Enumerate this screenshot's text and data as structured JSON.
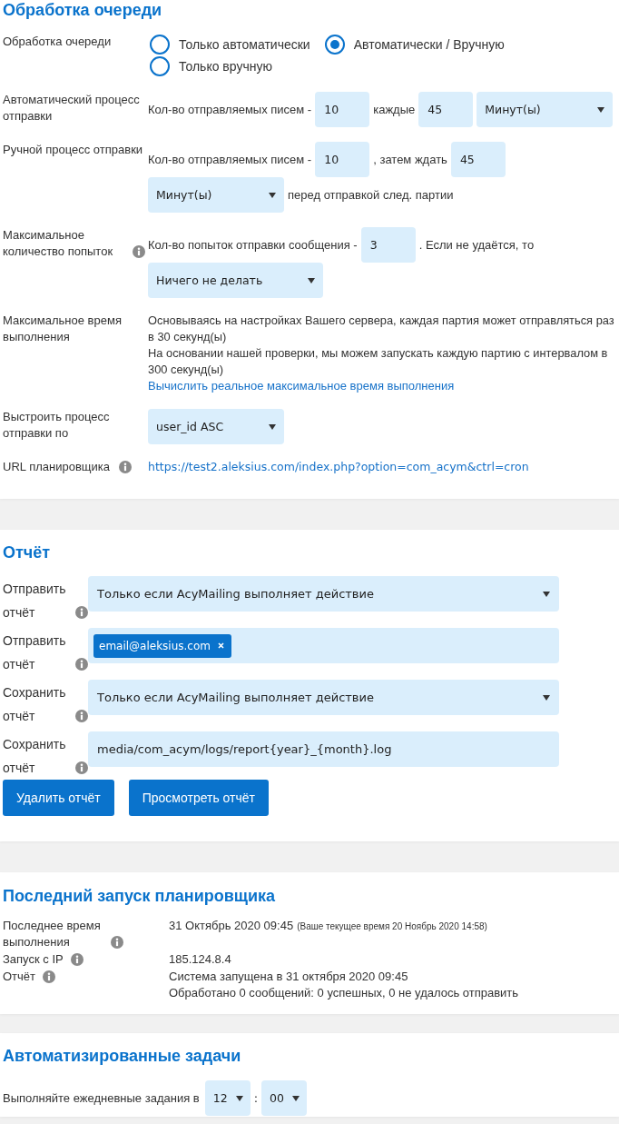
{
  "queue": {
    "title": "Обработка очереди",
    "rows": [
      {
        "label": "Обработка очереди",
        "info": false,
        "parts": [
          {
            "kind": "radio",
            "label": "Только автоматически",
            "selected": false
          },
          {
            "kind": "radio",
            "label": "Автоматически / Вручную",
            "selected": true
          },
          {
            "kind": "radio",
            "label": "Только вручную",
            "selected": false
          }
        ]
      },
      {
        "label": "Автоматический процесс отправки",
        "info": false,
        "parts": [
          {
            "kind": "text",
            "text": "Кол-во отправляемых писем -"
          },
          {
            "kind": "input",
            "value": "10"
          },
          {
            "kind": "text",
            "text": "каждые"
          },
          {
            "kind": "input",
            "value": "45"
          },
          {
            "kind": "select",
            "value": "Минут(ы)"
          }
        ]
      },
      {
        "label": "Ручной процесс отправки",
        "info": false,
        "parts": [
          {
            "kind": "text",
            "text": "Кол-во отправляемых писем -"
          },
          {
            "kind": "input",
            "value": "10"
          },
          {
            "kind": "text",
            "text": ", затем ждать"
          },
          {
            "kind": "input",
            "value": "45"
          },
          {
            "kind": "select",
            "value": "Минут(ы)"
          },
          {
            "kind": "text",
            "text": "перед отправкой след. партии"
          }
        ]
      },
      {
        "label": "Максимальное количество попыток",
        "info": true,
        "parts": [
          {
            "kind": "text",
            "text": "Кол-во попыток отправки сообщения -"
          },
          {
            "kind": "input",
            "value": "3"
          },
          {
            "kind": "text",
            "text": ". Если не удаётся, то"
          },
          {
            "kind": "select",
            "value": "Ничего не делать"
          }
        ]
      },
      {
        "label": "Максимальное время выполнения",
        "info": false,
        "parts": [
          {
            "kind": "paragraph",
            "text": "Основываясь на настройках Вашего сервера, каждая партия может отправляться раз в 30 секунд(ы)"
          },
          {
            "kind": "paragraph",
            "text": "На основании нашей проверки, мы можем запускать каждую партию с интервалом в 300 секунд(ы)"
          },
          {
            "kind": "link",
            "text": "Вычислить реальное максимальное время выполнения"
          }
        ]
      },
      {
        "label": "Выстроить процесс отправки по",
        "info": false,
        "parts": [
          {
            "kind": "select",
            "value": "user_id ASC"
          }
        ]
      },
      {
        "label": "URL планировщика",
        "info": true,
        "parts": [
          {
            "kind": "url",
            "text": "https://test2.aleksius.com/index.php?option=com_acym&ctrl=cron"
          }
        ]
      }
    ]
  },
  "report": {
    "title": "Отчёт",
    "rows": [
      {
        "label": "Отправить отчёт",
        "info": true,
        "field": {
          "kind": "select",
          "value": "Только если AcyMailing выполняет действие"
        }
      },
      {
        "label": "Отправить отчёт",
        "info": true,
        "field": {
          "kind": "tags",
          "tags": [
            "email@aleksius.com"
          ]
        }
      },
      {
        "label": "Сохранить отчёт",
        "info": true,
        "field": {
          "kind": "select",
          "value": "Только если AcyMailing выполняет действие"
        }
      },
      {
        "label": "Сохранить отчёт",
        "info": true,
        "field": {
          "kind": "input",
          "value": "media/com_acym/logs/report{year}_{month}.log"
        }
      }
    ],
    "buttons": [
      "Удалить отчёт",
      "Просмотреть отчёт"
    ]
  },
  "last_run": {
    "title": "Последний запуск планировщика",
    "rows": [
      {
        "label": "Последнее время выполнения",
        "info": true,
        "values": [
          {
            "text": "31 Октябрь 2020 09:45",
            "note": "(Ваше текущее время 20 Ноябрь 2020 14:58)"
          }
        ]
      },
      {
        "label": "Запуск с IP",
        "info": true,
        "values": [
          {
            "text": "185.124.8.4"
          }
        ]
      },
      {
        "label": "Отчёт",
        "info": true,
        "values": [
          {
            "text": "Система запущена в 31 октября 2020 09:45"
          },
          {
            "text": "Обработано 0 сообщений: 0 успешных, 0 не удалось отправить"
          }
        ]
      }
    ]
  },
  "automated_tasks": {
    "title": "Автоматизированные задачи",
    "label": "Выполняйте ежедневные задания в",
    "hour": "12",
    "separator": ":",
    "minute": "00"
  }
}
